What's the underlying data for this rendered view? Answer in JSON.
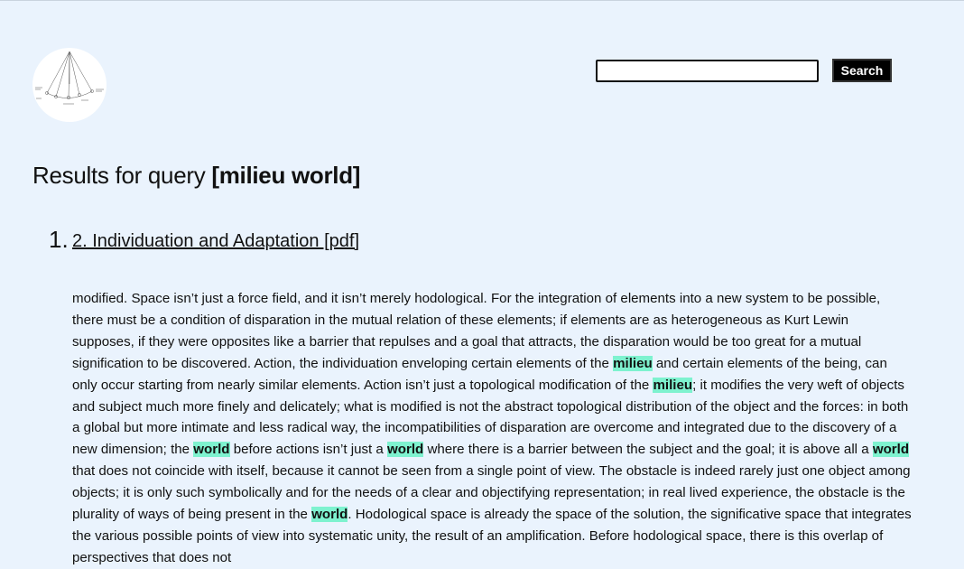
{
  "header": {
    "logo_alt": "logo",
    "search": {
      "value": "",
      "placeholder": ""
    },
    "search_button_label": "Search"
  },
  "results": {
    "heading_prefix": "Results for query ",
    "query_display": "[milieu world]",
    "items": [
      {
        "number": "1.",
        "title": "2. Individuation and Adaptation [pdf]",
        "snippet_segments": [
          {
            "text": "modified. Space isn’t just a force field, and it isn’t merely hodological. For the integration of elements into a new system to be possible, there must be a condition of disparation in the mutual relation of these elements; if elements are as heterogeneous as Kurt Lewin supposes, if they were opposites like a barrier that repulses and a goal that attracts, the disparation would be too great for a mutual signification to be discovered. Action, the individuation enveloping certain elements of the ",
            "highlight": false
          },
          {
            "text": "milieu",
            "highlight": true
          },
          {
            "text": " and certain elements of the being, can only occur starting from nearly similar elements. Action isn’t just a topological modification of the ",
            "highlight": false
          },
          {
            "text": "milieu",
            "highlight": true
          },
          {
            "text": "; it modifies the very weft of objects and subject much more finely and delicately; what is modified is not the abstract topological distribution of the object and the forces: in both a global but more intimate and less radical way, the incompatibilities of disparation are overcome and integrated due to the discovery of a new dimension; the ",
            "highlight": false
          },
          {
            "text": "world",
            "highlight": true
          },
          {
            "text": " before actions isn’t just a ",
            "highlight": false
          },
          {
            "text": "world",
            "highlight": true
          },
          {
            "text": " where there is a barrier between the subject and the goal; it is above all a ",
            "highlight": false
          },
          {
            "text": "world",
            "highlight": true
          },
          {
            "text": " that does not coincide with itself, because it cannot be seen from a single point of view. The obstacle is indeed rarely just one object among objects; it is only such symbolically and for the needs of a clear and objectifying representation; in real lived experience, the obstacle is the plurality of ways of being present in the ",
            "highlight": false
          },
          {
            "text": "world",
            "highlight": true
          },
          {
            "text": ". Hodological space is already the space of the solution, the significative space that integrates the various possible points of view into systematic unity, the result of an amplification. Before hodological space, there is this overlap of perspectives that does not",
            "highlight": false
          }
        ]
      }
    ]
  }
}
